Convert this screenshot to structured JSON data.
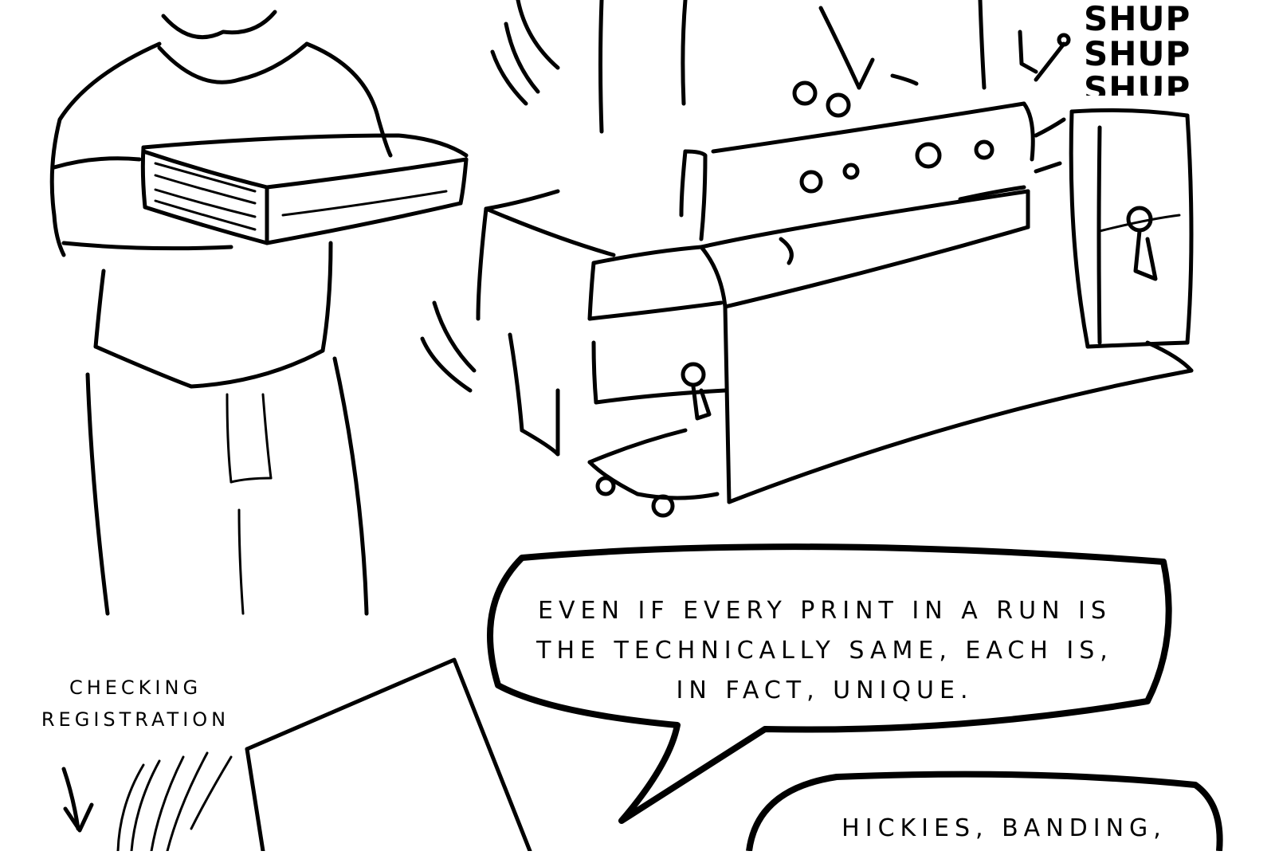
{
  "sound_effect": [
    "SHUP",
    "SHUP",
    "SHUP"
  ],
  "speech_bubble_1": {
    "lines": [
      "Even if every print in a run is",
      "the technically same, each is,",
      "in fact, unique."
    ]
  },
  "speech_bubble_2": {
    "text": "Hickies, banding,"
  },
  "caption": {
    "lines": [
      "Checking",
      "registration"
    ]
  }
}
